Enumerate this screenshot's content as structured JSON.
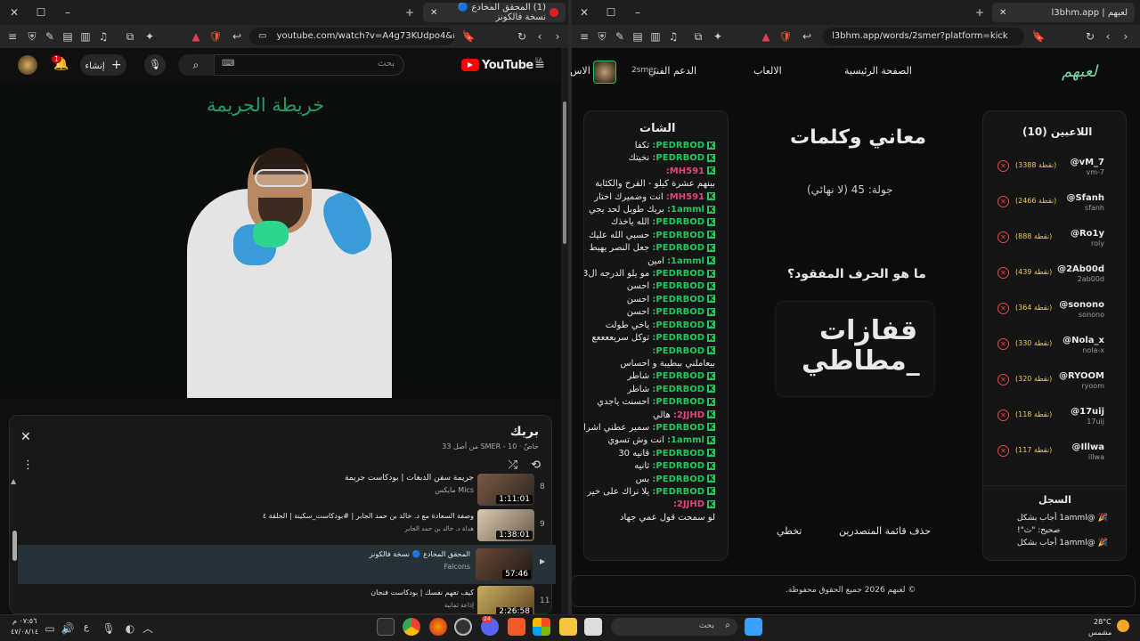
{
  "left": {
    "tab_active": "(1) المحقق المخادع 🔵 نسخة فالكونز",
    "tab_badge": "1",
    "url": "youtube.com/watch?v=A4g73KUdpo4&lis...",
    "yt": {
      "logo": "YouTube",
      "country": "SA",
      "search_placeholder": "بحث",
      "create_label": "إنشاء",
      "notif_count": "1"
    },
    "video": {
      "overlay_title": "خريطة الجريمة"
    },
    "playlist": {
      "title": "بريك",
      "meta": "خاصّ · SMER - 10 من أصل 33",
      "items": [
        {
          "num": "8",
          "title": "جريمة سفن الدبغات | بودكاست جريمة",
          "channel": "Mics مايكس",
          "duration": "1:11:01"
        },
        {
          "num": "9",
          "title": "وصفة السعادة مع د. خالد بن حمد الجابر | #بودكاست_سكينة | الحلقة ٤",
          "channel": "هداة د. خالد بن حمد الجابر",
          "duration": "1:38:01"
        },
        {
          "num": "▶",
          "title": "المحقق المخادع 🔵 نسخة فالكونز",
          "channel": "Falcons",
          "duration": "57:46"
        },
        {
          "num": "11",
          "title": "كيف تفهم نفسك | بودكاست فنجان",
          "channel": "إذاعة ثمانية",
          "duration": "2:26:58"
        }
      ]
    }
  },
  "right": {
    "tab_title": "لعبهم | l3bhm.app",
    "url": "l3bhm.app/words/2smer?platform=kick",
    "nav": {
      "logo": "لعبهم",
      "home": "الصفحة الرئيسية",
      "games": "الالعاب",
      "support": "الدعم الفني",
      "username": "2smer",
      "extra": "الاس"
    },
    "players_title": "اللاعبين (10)",
    "players": [
      {
        "name": "@vM_7",
        "handle": "vm-7",
        "score": "(3388 نقطة)"
      },
      {
        "name": "@Sfanh",
        "handle": "sfanh",
        "score": "(2466 نقطة)"
      },
      {
        "name": "@Ro1y",
        "handle": "roly",
        "score": "(888 نقطة)"
      },
      {
        "name": "@2Ab00d",
        "handle": "2ab00d",
        "score": "(439 نقطة)"
      },
      {
        "name": "@sonono",
        "handle": "sonono",
        "score": "(364 نقطة)"
      },
      {
        "name": "@Nola_x",
        "handle": "nola-x",
        "score": "(330 نقطة)"
      },
      {
        "name": "@RYOOM",
        "handle": "ryoom",
        "score": "(320 نقطة)"
      },
      {
        "name": "@17uij",
        "handle": "17uij",
        "score": "(118 نقطة)"
      },
      {
        "name": "@Illwa",
        "handle": "illwa",
        "score": "(117 نقطة)"
      }
    ],
    "log_title": "السجل",
    "log": [
      "🎉 @1amml أجاب بشكل",
      "صحيح: \"ث\"!",
      "🎉 @1amml أجاب بشكل"
    ],
    "game": {
      "title": "معاني وكلمات",
      "round": "جولة: 45 (لا نهائي)",
      "question": "ما هو الحرف المفقود؟",
      "puzzle_line1": "قفازات",
      "puzzle_line2": "مطاطي_"
    },
    "actions": {
      "clear": "حذف قائمة المتصدرين",
      "skip": "تخطي"
    },
    "chat_title": "الشات",
    "chat": [
      {
        "user": "PEDRBOD:",
        "msg": "تكفا",
        "color": "#22c55e"
      },
      {
        "user": "PEDRBOD:",
        "msg": "نخيتك",
        "color": "#22c55e"
      },
      {
        "user": "MH591:",
        "msg": "",
        "color": "#e0457b"
      },
      {
        "user": "",
        "msg": "بينهم عشرة كيلو - الفرح والكئابة",
        "color": "#22c55e"
      },
      {
        "user": "MH591:",
        "msg": "انت وضميرك اختار",
        "color": "#e0457b"
      },
      {
        "user": "1amml:",
        "msg": "بريك طويل لحد يجي",
        "color": "#22c55e"
      },
      {
        "user": "PEDRBOD:",
        "msg": "الله ياخذك",
        "color": "#22c55e"
      },
      {
        "user": "PEDRBOD:",
        "msg": "حسبي الله عليك",
        "color": "#22c55e"
      },
      {
        "user": "PEDRBOD:",
        "msg": "جعل النصر يهبط",
        "color": "#22c55e"
      },
      {
        "user": "1amml:",
        "msg": "امين",
        "color": "#22c55e"
      },
      {
        "user": "PEDRBOD:",
        "msg": "مو يلو الدرجه ال3",
        "color": "#22c55e"
      },
      {
        "user": "PEDRBOD:",
        "msg": "احسن",
        "color": "#22c55e"
      },
      {
        "user": "PEDRBOD:",
        "msg": "احسن",
        "color": "#22c55e"
      },
      {
        "user": "PEDRBOD:",
        "msg": "احسن",
        "color": "#22c55e"
      },
      {
        "user": "PEDRBOD:",
        "msg": "ياخي طولت",
        "color": "#22c55e"
      },
      {
        "user": "PEDRBOD:",
        "msg": "توكل سريععععع",
        "color": "#22c55e"
      },
      {
        "user": "PEDRBOD:",
        "msg": "",
        "color": "#22c55e"
      },
      {
        "user": "",
        "msg": "بيعاملني ببطيبة و احساس",
        "color": "#22c55e"
      },
      {
        "user": "PEDRBOD:",
        "msg": "شاطر",
        "color": "#22c55e"
      },
      {
        "user": "PEDRBOD:",
        "msg": "شاطر",
        "color": "#22c55e"
      },
      {
        "user": "PEDRBOD:",
        "msg": "احسنت ياجدي",
        "color": "#22c55e"
      },
      {
        "user": "2JJHD:",
        "msg": "هالي",
        "color": "#e0457b"
      },
      {
        "user": "PEDRBOD:",
        "msg": "سمير عطني اشراف",
        "color": "#22c55e"
      },
      {
        "user": "1amml:",
        "msg": "انت وش تسوي",
        "color": "#22c55e"
      },
      {
        "user": "PEDRBOD:",
        "msg": "قانيه 30",
        "color": "#22c55e"
      },
      {
        "user": "PEDRBOD:",
        "msg": "ثانيه",
        "color": "#22c55e"
      },
      {
        "user": "PEDRBOD:",
        "msg": "بس",
        "color": "#22c55e"
      },
      {
        "user": "PEDRBOD:",
        "msg": "يلا نراك على خير",
        "color": "#22c55e"
      },
      {
        "user": "2JJHD:",
        "msg": "",
        "color": "#e0457b"
      },
      {
        "user": "",
        "msg": "لو سمحت قول عمي جهاد",
        "color": "#22c55e"
      }
    ],
    "footer": "© لعبهم 2026 جميع الحقوق محفوظة."
  },
  "taskbar": {
    "search_placeholder": "بحث",
    "weather_temp": "28°C",
    "weather_desc": "مشمس",
    "time": "٠٧:٥٦ م",
    "date": "٤٧/٠٨/١٤",
    "lang": "ع",
    "discord_badge": "24"
  }
}
